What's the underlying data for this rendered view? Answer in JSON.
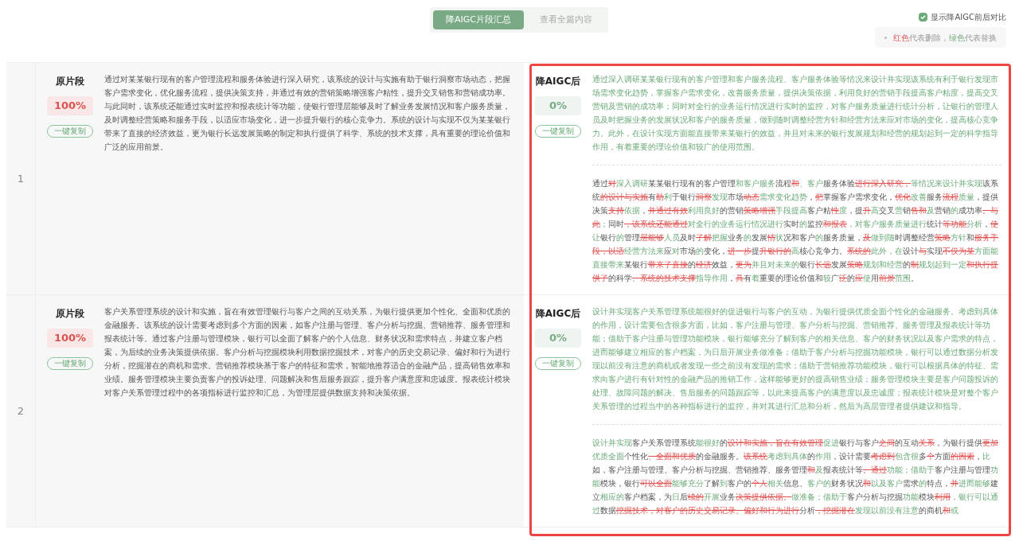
{
  "tabs": [
    {
      "label": "降AIGC片段汇总",
      "selected": true
    },
    {
      "label": "查看全篇内容",
      "selected": false
    }
  ],
  "show_compare": {
    "label": "显示降AIGC前后对比",
    "checked": true
  },
  "legend": [
    {
      "text": "红色",
      "kind": "red"
    },
    {
      "text": "代表删除，",
      "kind": "plain"
    },
    {
      "text": "绿色",
      "kind": "green"
    },
    {
      "text": "代表替换",
      "kind": "plain"
    }
  ],
  "rewritten_highlighted": true,
  "rows": [
    {
      "index": "1",
      "original": {
        "label": "原片段",
        "score": "100%",
        "copy_button": "一键复制",
        "text": "通过对某某银行现有的客户管理流程和服务体验进行深入研究，该系统的设计与实施有助于银行洞察市场动态，把握客户需求变化，优化服务流程，提供决策支持，并通过有效的营销策略增强客户粘性，提升交叉销售和营销成功率。与此同时，该系统还能通过实时监控和报表统计等功能，使银行管理层能够及时了解业务发展情况和客户服务质量，及时调整经营策略和服务手段，以适应市场变化，进一步提升银行的核心竞争力。系统的设计与实现不仅为某某银行带来了直接的经济效益，更为银行长远发展策略的制定和执行提供了科学、系统的技术支撑，具有重要的理论价值和广泛的应用前景。"
      },
      "rewritten": {
        "label": "降AIGC后",
        "score": "0%",
        "copy_button": "一键复制",
        "text": "通过深入调研某某银行现有的客户管理和客户服务流程、客户服务体验等情况来设计并实现该系统有利于银行发现市场需求变化趋势，掌握客户需求变化，改善服务质量，提供决策依据，利用良好的营销手段提高客户粘度，提高交叉营销及营销的成功率；同时对全行的业务运行情况进行实时的监控，对客户服务质量进行统计分析，让银行的管理人员及时把握业务的发展状况和客户的服务质量，做到随时调整经营方针和经营方法来应对市场的变化，提高核心竞争力。此外，在设计实现方面能直接带来某银行的效益，并且对未来的银行发展规划和经营的规划起到一定的科学指导作用，有着重要的理论价值和较广的使用范围。",
        "diff": [
          {
            "kind": "same",
            "text": "通过"
          },
          {
            "kind": "del",
            "text": "对"
          },
          {
            "kind": "add",
            "text": "深入调研"
          },
          {
            "kind": "same",
            "text": "某某银行现有的客户管理"
          },
          {
            "kind": "add",
            "text": "和客户服务"
          },
          {
            "kind": "same",
            "text": "流程"
          },
          {
            "kind": "del",
            "text": "和"
          },
          {
            "kind": "add",
            "text": "、客户"
          },
          {
            "kind": "same",
            "text": "服务体验"
          },
          {
            "kind": "del",
            "text": "进行深入研究，"
          },
          {
            "kind": "add",
            "text": "等情况来设计并实现"
          },
          {
            "kind": "same",
            "text": "该系统"
          },
          {
            "kind": "del",
            "text": "的设计与实施"
          },
          {
            "kind": "same",
            "text": "有"
          },
          {
            "kind": "del",
            "text": "助"
          },
          {
            "kind": "add",
            "text": "利"
          },
          {
            "kind": "same",
            "text": "于银行"
          },
          {
            "kind": "del",
            "text": "洞察"
          },
          {
            "kind": "add",
            "text": "发现"
          },
          {
            "kind": "same",
            "text": "市场"
          },
          {
            "kind": "del",
            "text": "动态"
          },
          {
            "kind": "add",
            "text": "需求变化趋势"
          },
          {
            "kind": "same",
            "text": "，"
          },
          {
            "kind": "del",
            "text": "把"
          },
          {
            "kind": "same",
            "text": "掌握客户需求变化，"
          },
          {
            "kind": "del",
            "text": "优化"
          },
          {
            "kind": "add",
            "text": "改善"
          },
          {
            "kind": "same",
            "text": "服务"
          },
          {
            "kind": "del",
            "text": "流程"
          },
          {
            "kind": "add",
            "text": "质量"
          },
          {
            "kind": "same",
            "text": "，提供决策"
          },
          {
            "kind": "del",
            "text": "支持"
          },
          {
            "kind": "add",
            "text": "依据"
          },
          {
            "kind": "same",
            "text": "，"
          },
          {
            "kind": "del",
            "text": "并通过有效"
          },
          {
            "kind": "add",
            "text": "利用良好"
          },
          {
            "kind": "same",
            "text": "的营销"
          },
          {
            "kind": "del",
            "text": "策略增强"
          },
          {
            "kind": "add",
            "text": "手段提高"
          },
          {
            "kind": "same",
            "text": "客户粘"
          },
          {
            "kind": "del",
            "text": "性"
          },
          {
            "kind": "add",
            "text": "度"
          },
          {
            "kind": "same",
            "text": "，提"
          },
          {
            "kind": "del",
            "text": "升"
          },
          {
            "kind": "add",
            "text": "高"
          },
          {
            "kind": "same",
            "text": "交叉"
          },
          {
            "kind": "add",
            "text": "营"
          },
          {
            "kind": "same",
            "text": "销"
          },
          {
            "kind": "del",
            "text": "售和"
          },
          {
            "kind": "add",
            "text": "及"
          },
          {
            "kind": "same",
            "text": "营销"
          },
          {
            "kind": "add",
            "text": "的"
          },
          {
            "kind": "same",
            "text": "成功率"
          },
          {
            "kind": "del",
            "text": "。与此"
          },
          {
            "kind": "add",
            "text": "；"
          },
          {
            "kind": "same",
            "text": "同时"
          },
          {
            "kind": "del",
            "text": "，该系统还能通过"
          },
          {
            "kind": "add",
            "text": "对全行的业务运行情况进行"
          },
          {
            "kind": "same",
            "text": "实时"
          },
          {
            "kind": "add",
            "text": "的"
          },
          {
            "kind": "same",
            "text": "监控"
          },
          {
            "kind": "del",
            "text": "和报表"
          },
          {
            "kind": "add",
            "text": "，对客户服务质量进行"
          },
          {
            "kind": "same",
            "text": "统计"
          },
          {
            "kind": "del",
            "text": "等功能"
          },
          {
            "kind": "add",
            "text": "分析"
          },
          {
            "kind": "same",
            "text": "，"
          },
          {
            "kind": "del",
            "text": "使"
          },
          {
            "kind": "add",
            "text": "让"
          },
          {
            "kind": "same",
            "text": "银行"
          },
          {
            "kind": "add",
            "text": "的"
          },
          {
            "kind": "same",
            "text": "管理"
          },
          {
            "kind": "del",
            "text": "层能够"
          },
          {
            "kind": "add",
            "text": "人员"
          },
          {
            "kind": "same",
            "text": "及时"
          },
          {
            "kind": "del",
            "text": "了解"
          },
          {
            "kind": "add",
            "text": "把握"
          },
          {
            "kind": "same",
            "text": "业务"
          },
          {
            "kind": "add",
            "text": "的"
          },
          {
            "kind": "same",
            "text": "发展"
          },
          {
            "kind": "del",
            "text": "情"
          },
          {
            "kind": "add",
            "text": "状"
          },
          {
            "kind": "same",
            "text": "况和客户"
          },
          {
            "kind": "add",
            "text": "的"
          },
          {
            "kind": "same",
            "text": "服务质量，"
          },
          {
            "kind": "del",
            "text": "及"
          },
          {
            "kind": "add",
            "text": "做到随"
          },
          {
            "kind": "same",
            "text": "时调整经营"
          },
          {
            "kind": "del",
            "text": "策略"
          },
          {
            "kind": "add",
            "text": "方针"
          },
          {
            "kind": "same",
            "text": "和"
          },
          {
            "kind": "del",
            "text": "服务手段，以适"
          },
          {
            "kind": "add",
            "text": "经营方法来"
          },
          {
            "kind": "same",
            "text": "应"
          },
          {
            "kind": "add",
            "text": "对"
          },
          {
            "kind": "same",
            "text": "市场"
          },
          {
            "kind": "add",
            "text": "的"
          },
          {
            "kind": "same",
            "text": "变化，"
          },
          {
            "kind": "del",
            "text": "进一步"
          },
          {
            "kind": "same",
            "text": "提"
          },
          {
            "kind": "del",
            "text": "升银行的"
          },
          {
            "kind": "add",
            "text": "高"
          },
          {
            "kind": "same",
            "text": "核心竞争力。"
          },
          {
            "kind": "del",
            "text": "系统的"
          },
          {
            "kind": "add",
            "text": "此外，在"
          },
          {
            "kind": "same",
            "text": "设计"
          },
          {
            "kind": "del",
            "text": "与"
          },
          {
            "kind": "same",
            "text": "实现"
          },
          {
            "kind": "del",
            "text": "不仅为某"
          },
          {
            "kind": "add",
            "text": "方面能直接带来"
          },
          {
            "kind": "same",
            "text": "某银行"
          },
          {
            "kind": "del",
            "text": "带来了直接"
          },
          {
            "kind": "same",
            "text": "的"
          },
          {
            "kind": "del",
            "text": "经济"
          },
          {
            "kind": "same",
            "text": "效益，"
          },
          {
            "kind": "del",
            "text": "更为"
          },
          {
            "kind": "add",
            "text": "并且对未来的"
          },
          {
            "kind": "same",
            "text": "银行"
          },
          {
            "kind": "del",
            "text": "长远"
          },
          {
            "kind": "same",
            "text": "发展"
          },
          {
            "kind": "del",
            "text": "策略"
          },
          {
            "kind": "add",
            "text": "规划和经营"
          },
          {
            "kind": "same",
            "text": "的"
          },
          {
            "kind": "del",
            "text": "制"
          },
          {
            "kind": "add",
            "text": "规划起到一定"
          },
          {
            "kind": "del",
            "text": "和执行提供了"
          },
          {
            "kind": "same",
            "text": "的科学"
          },
          {
            "kind": "del",
            "text": "、系统的技术支撑"
          },
          {
            "kind": "add",
            "text": "指导作用"
          },
          {
            "kind": "same",
            "text": "，"
          },
          {
            "kind": "del",
            "text": "具"
          },
          {
            "kind": "same",
            "text": "有"
          },
          {
            "kind": "add",
            "text": "着"
          },
          {
            "kind": "same",
            "text": "重要的理论价值和"
          },
          {
            "kind": "add",
            "text": "较"
          },
          {
            "kind": "same",
            "text": "广"
          },
          {
            "kind": "del",
            "text": "泛"
          },
          {
            "kind": "same",
            "text": "的"
          },
          {
            "kind": "del",
            "text": "应"
          },
          {
            "kind": "add",
            "text": "使"
          },
          {
            "kind": "same",
            "text": "用"
          },
          {
            "kind": "del",
            "text": "前景"
          },
          {
            "kind": "add",
            "text": "范围"
          },
          {
            "kind": "same",
            "text": "。"
          }
        ]
      }
    },
    {
      "index": "2",
      "original": {
        "label": "原片段",
        "score": "100%",
        "copy_button": "一键复制",
        "text": "客户关系管理系统的设计和实施，旨在有效管理银行与客户之间的互动关系，为银行提供更加个性化、全面和优质的金融服务。该系统的设计需要考虑到多个方面的因素，如客户注册与管理、客户分析与挖掘、营销推荐、服务管理和报表统计等。通过客户注册与管理模块，银行可以全面了解客户的个人信息、财务状况和需求特点，并建立客户档案，为后续的业务决策提供依据。客户分析与挖掘模块利用数据挖掘技术，对客户的历史交易记录、偏好和行为进行分析，挖掘潜在的商机和需求。营销推荐模块基于客户的特征和需求，智能地推荐适合的金融产品，提高销售效率和业绩。服务管理模块主要负责客户的投诉处理、问题解决和售后服务跟踪，提升客户满意度和忠诚度。报表统计模块对客户关系管理过程中的各项指标进行监控和汇总，为管理层提供数据支持和决策依据。"
      },
      "rewritten": {
        "label": "降AIGC后",
        "score": "0%",
        "copy_button": "一键复制",
        "text": "设计并实现客户关系管理系统能很好的促进银行与客户的互动，为银行提供优质全面个性化的金融服务。考虑到具体的作用，设计需要包含很多方面，比如，客户注册与管理、客户分析与挖掘、营销推荐、服务管理及报表统计等功能；借助于客户注册与管理功能模块，银行能够充分了解到客户的相关信息、客户的财务状况以及客户需求的特点，进而能够建立相应的客户档案，为日后开展业务做准备；借助于客户分析与挖掘功能模块，银行可以通过数据分析发现以前没有注意的商机或者发现一些之前没有发现的需求；借助于营销推荐功能模块，银行可以根据具体的特征、需求向客户进行有针对性的金融产品的推销工作，这样能够更好的提高销售业绩；服务管理模块主要是客户问题投诉的处理、故障问题的解决、售后服务的问题跟踪等，以此来提高客户的满意度以及忠诚度；报表统计模块是对整个客户关系管理的过程当中的各种指标进行的监控，并对其进行汇总和分析，然后为高层管理者提供建议和指导。",
        "diff": [
          {
            "kind": "add",
            "text": "设计并实现"
          },
          {
            "kind": "same",
            "text": "客户关系管理系统"
          },
          {
            "kind": "add",
            "text": "能很好"
          },
          {
            "kind": "same",
            "text": "的"
          },
          {
            "kind": "del",
            "text": "设计和实施，旨在有效管理"
          },
          {
            "kind": "add",
            "text": "促进"
          },
          {
            "kind": "same",
            "text": "银行与客户"
          },
          {
            "kind": "del",
            "text": "之间"
          },
          {
            "kind": "same",
            "text": "的互动"
          },
          {
            "kind": "del",
            "text": "关系"
          },
          {
            "kind": "same",
            "text": "，为银行提供"
          },
          {
            "kind": "del",
            "text": "更加"
          },
          {
            "kind": "add",
            "text": "优质全面"
          },
          {
            "kind": "same",
            "text": "个性化"
          },
          {
            "kind": "del",
            "text": "、全面和优质"
          },
          {
            "kind": "same",
            "text": "的金融服务。"
          },
          {
            "kind": "del",
            "text": "该系统"
          },
          {
            "kind": "add",
            "text": "考虑到具体"
          },
          {
            "kind": "same",
            "text": "的"
          },
          {
            "kind": "add",
            "text": "作用"
          },
          {
            "kind": "same",
            "text": "，设计需要"
          },
          {
            "kind": "del",
            "text": "考虑到"
          },
          {
            "kind": "add",
            "text": "包含很"
          },
          {
            "kind": "same",
            "text": "多"
          },
          {
            "kind": "del",
            "text": "个"
          },
          {
            "kind": "same",
            "text": "方面"
          },
          {
            "kind": "del",
            "text": "的因素"
          },
          {
            "kind": "same",
            "text": "，"
          },
          {
            "kind": "add",
            "text": "比"
          },
          {
            "kind": "same",
            "text": "如，客户注册与管理、客户分析与挖掘、营销推荐、服务管理"
          },
          {
            "kind": "del",
            "text": "和"
          },
          {
            "kind": "add",
            "text": "及"
          },
          {
            "kind": "same",
            "text": "报表统计等"
          },
          {
            "kind": "del",
            "text": "。通过"
          },
          {
            "kind": "add",
            "text": "功能；借助于"
          },
          {
            "kind": "same",
            "text": "客户注册与管理"
          },
          {
            "kind": "add",
            "text": "功能"
          },
          {
            "kind": "same",
            "text": "模块，银行"
          },
          {
            "kind": "del",
            "text": "可以全面"
          },
          {
            "kind": "add",
            "text": "能够充分"
          },
          {
            "kind": "same",
            "text": "了解"
          },
          {
            "kind": "add",
            "text": "到"
          },
          {
            "kind": "same",
            "text": "客户的"
          },
          {
            "kind": "del",
            "text": "个人"
          },
          {
            "kind": "add",
            "text": "相关"
          },
          {
            "kind": "same",
            "text": "信息、"
          },
          {
            "kind": "add",
            "text": "客户的"
          },
          {
            "kind": "same",
            "text": "财务状况"
          },
          {
            "kind": "del",
            "text": "和"
          },
          {
            "kind": "add",
            "text": "以及客户"
          },
          {
            "kind": "same",
            "text": "需求"
          },
          {
            "kind": "add",
            "text": "的"
          },
          {
            "kind": "same",
            "text": "特点，"
          },
          {
            "kind": "del",
            "text": "并"
          },
          {
            "kind": "add",
            "text": "进而能够"
          },
          {
            "kind": "same",
            "text": "建立"
          },
          {
            "kind": "add",
            "text": "相应的"
          },
          {
            "kind": "same",
            "text": "客户档案，为"
          },
          {
            "kind": "add",
            "text": "日"
          },
          {
            "kind": "same",
            "text": "后"
          },
          {
            "kind": "del",
            "text": "续的"
          },
          {
            "kind": "add",
            "text": "开展"
          },
          {
            "kind": "same",
            "text": "业务"
          },
          {
            "kind": "del",
            "text": "决策提供依据。"
          },
          {
            "kind": "add",
            "text": "做准备；借助于"
          },
          {
            "kind": "same",
            "text": "客户分析与挖掘"
          },
          {
            "kind": "add",
            "text": "功能"
          },
          {
            "kind": "same",
            "text": "模块"
          },
          {
            "kind": "del",
            "text": "利用"
          },
          {
            "kind": "add",
            "text": "，银行可以通过"
          },
          {
            "kind": "same",
            "text": "数据"
          },
          {
            "kind": "del",
            "text": "挖掘技术，对客户的历史交易记录、偏好和行为进行"
          },
          {
            "kind": "same",
            "text": "分析"
          },
          {
            "kind": "del",
            "text": "，挖掘潜在"
          },
          {
            "kind": "add",
            "text": "发现以前没有注意"
          },
          {
            "kind": "same",
            "text": "的商机"
          },
          {
            "kind": "del",
            "text": "和"
          },
          {
            "kind": "add",
            "text": "或"
          }
        ]
      }
    }
  ]
}
